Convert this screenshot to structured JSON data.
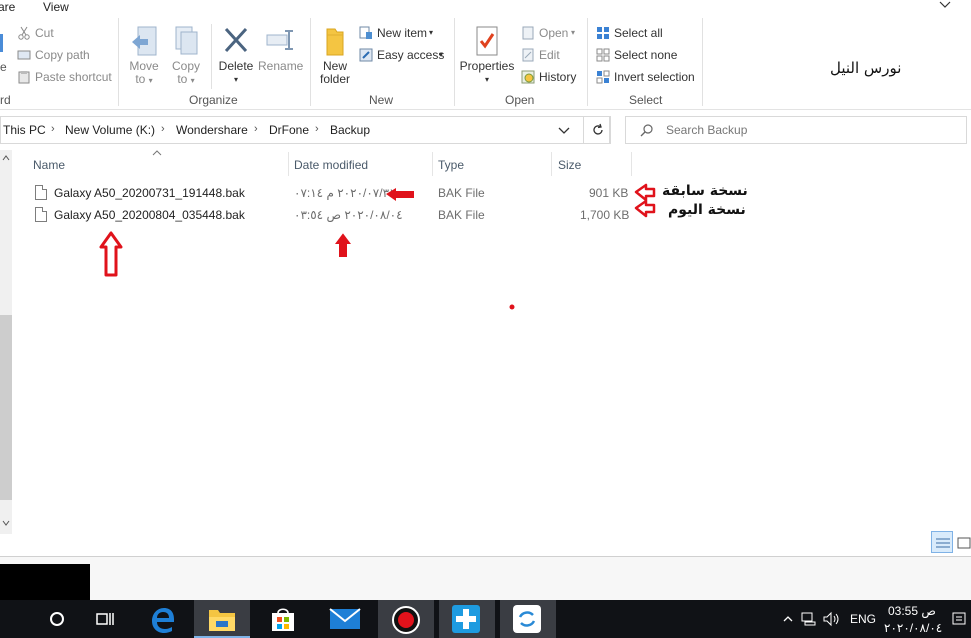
{
  "ribbon": {
    "tabs": [
      "are",
      "View"
    ],
    "clipboard": {
      "cut": "Cut",
      "copy_path": "Copy path",
      "paste_shortcut": "Paste shortcut",
      "label_fragment": "rd",
      "left_fragment": "e"
    },
    "organize": {
      "move_to": [
        "Move",
        "to"
      ],
      "copy_to": [
        "Copy",
        "to"
      ],
      "delete": "Delete",
      "rename": "Rename",
      "label": "Organize"
    },
    "new": {
      "new_folder": [
        "New",
        "folder"
      ],
      "new_item": "New item",
      "easy_access": "Easy access",
      "label": "New"
    },
    "open": {
      "properties": "Properties",
      "open": "Open",
      "edit": "Edit",
      "history": "History",
      "label": "Open"
    },
    "select": {
      "select_all": "Select all",
      "select_none": "Select none",
      "invert_selection": "Invert selection",
      "label": "Select"
    },
    "watermark": "نورس النيل"
  },
  "address": {
    "crumbs": [
      "This PC",
      "New Volume (K:)",
      "Wondershare",
      "DrFone",
      "Backup"
    ],
    "search_placeholder": "Search Backup"
  },
  "columns": [
    "Name",
    "Date modified",
    "Type",
    "Size"
  ],
  "files": [
    {
      "name": "Galaxy A50_20200731_191448.bak",
      "date": "٢٠٢٠/٠٧/٣١ م ٠٧:١٤",
      "type": "BAK File",
      "size": "901 KB"
    },
    {
      "name": "Galaxy A50_20200804_035448.bak",
      "date": "٢٠٢٠/٠٨/٠٤ ص ٠٣:٥٤",
      "type": "BAK File",
      "size": "1,700 KB"
    }
  ],
  "annotations": {
    "previous_backup": "نسخة سابقة",
    "today_backup": "نسخة اليوم"
  },
  "taskbar": {
    "time": "03:55 ص",
    "date": "٢٠٢٠/٠٨/٠٤",
    "lang": "ENG"
  },
  "colors": {
    "annotation_red": "#e0121b",
    "taskbar": "#101216",
    "edge_blue": "#1e7fd6"
  }
}
